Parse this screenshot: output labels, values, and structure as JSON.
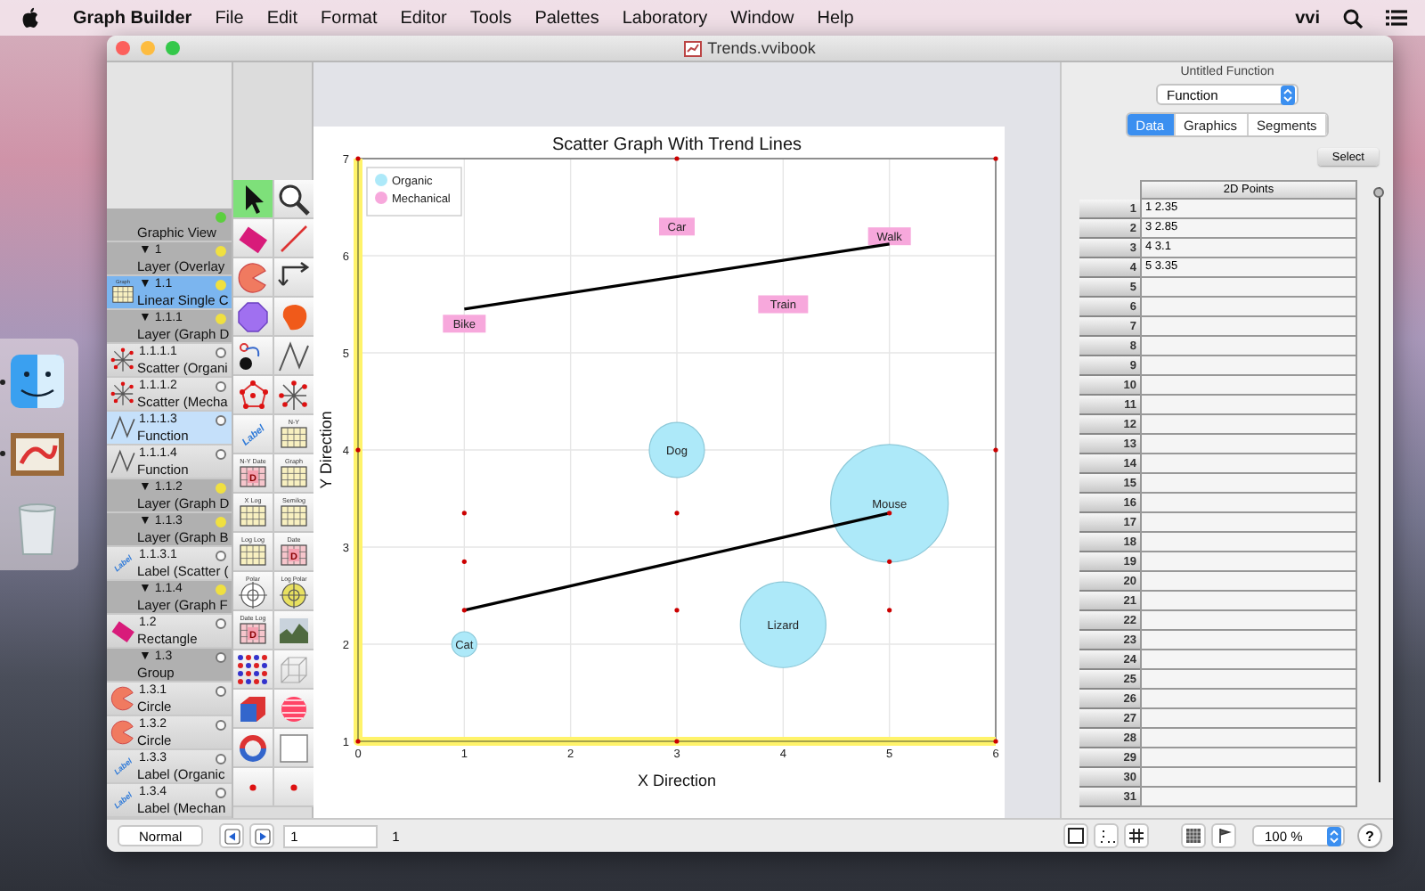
{
  "menubar": {
    "app": "Graph Builder",
    "menus": [
      "File",
      "Edit",
      "Format",
      "Editor",
      "Tools",
      "Palettes",
      "Laboratory",
      "Window",
      "Help"
    ],
    "user": "vvi"
  },
  "dock": {
    "items": [
      {
        "kind": "finder",
        "running": true
      },
      {
        "kind": "picture",
        "running": true
      },
      {
        "kind": "trash",
        "running": false
      }
    ]
  },
  "window": {
    "title": "Trends.vvibook"
  },
  "layers": [
    {
      "name": "Graphic View",
      "kind": "view",
      "color": "#5ccf3f",
      "selected": false,
      "editing": false,
      "children": [
        {
          "number": "▼ 1",
          "name": "Layer (Overlay",
          "kind": "layer",
          "color": "#f0e040",
          "selected": false,
          "editing": false,
          "children": [
            {
              "number": "▼ 1.1",
              "name": "Linear Single C",
              "kind": "graph",
              "icon_text": "Graph",
              "color": "#f0e040",
              "selected": true,
              "editing": false,
              "children": [
                {
                  "number": "▼ 1.1.1",
                  "name": "Layer (Graph D",
                  "kind": "layer",
                  "color": "#f0e040",
                  "selected": false,
                  "editing": false,
                  "children": [
                    {
                      "number": "1.1.1.1",
                      "name": "Scatter (Organi",
                      "kind": "scatter",
                      "selected": false,
                      "editing": false
                    },
                    {
                      "number": "1.1.1.2",
                      "name": "Scatter (Mecha",
                      "kind": "scatter",
                      "selected": false,
                      "editing": false
                    },
                    {
                      "number": "1.1.1.3",
                      "name": "Function",
                      "kind": "function",
                      "selected": false,
                      "editing": true
                    },
                    {
                      "number": "1.1.1.4",
                      "name": "Function",
                      "kind": "function",
                      "selected": false,
                      "editing": false
                    }
                  ]
                },
                {
                  "number": "▼ 1.1.2",
                  "name": "Layer (Graph D",
                  "kind": "layer",
                  "color": "#f0e040",
                  "selected": false,
                  "editing": false
                },
                {
                  "number": "▼ 1.1.3",
                  "name": "Layer (Graph B",
                  "kind": "layer",
                  "color": "#f0e040",
                  "selected": false,
                  "editing": false,
                  "children": [
                    {
                      "number": "1.1.3.1",
                      "name": "Label (Scatter (",
                      "kind": "label",
                      "icon_text": "Label",
                      "selected": false,
                      "editing": false
                    }
                  ]
                },
                {
                  "number": "▼ 1.1.4",
                  "name": "Layer (Graph F",
                  "kind": "layer",
                  "color": "#f0e040",
                  "selected": false,
                  "editing": false
                }
              ]
            },
            {
              "number": "1.2",
              "name": "Rectangle",
              "kind": "rectangle",
              "selected": false,
              "editing": false
            },
            {
              "number": "▼ 1.3",
              "name": "Group",
              "kind": "group",
              "selected": false,
              "editing": false,
              "children": [
                {
                  "number": "1.3.1",
                  "name": "Circle",
                  "kind": "circle",
                  "selected": false,
                  "editing": false
                },
                {
                  "number": "1.3.2",
                  "name": "Circle",
                  "kind": "circle",
                  "selected": false,
                  "editing": false
                },
                {
                  "number": "1.3.3",
                  "name": "Label (Organic",
                  "kind": "label",
                  "icon_text": "Label",
                  "selected": false,
                  "editing": false
                },
                {
                  "number": "1.3.4",
                  "name": "Label (Mechan",
                  "kind": "label",
                  "icon_text": "Label",
                  "selected": false,
                  "editing": false
                }
              ]
            }
          ]
        }
      ]
    }
  ],
  "tools": [
    {
      "kind": "pointer",
      "selected": true
    },
    {
      "kind": "zoom",
      "selected": false
    },
    {
      "kind": "rectangle",
      "selected": false
    },
    {
      "kind": "line",
      "selected": false
    },
    {
      "kind": "pie",
      "selected": false
    },
    {
      "kind": "connector",
      "selected": false
    },
    {
      "kind": "polygon",
      "selected": false
    },
    {
      "kind": "blob",
      "selected": false
    },
    {
      "kind": "curve",
      "selected": false
    },
    {
      "kind": "polyline",
      "selected": false
    },
    {
      "kind": "dots",
      "selected": false
    },
    {
      "kind": "scatter",
      "selected": false
    },
    {
      "kind": "label",
      "caption": "Label",
      "selected": false
    },
    {
      "kind": "grid",
      "caption": "N-Y",
      "selected": false
    },
    {
      "kind": "date",
      "caption": "N-Y Date",
      "letter": "D",
      "selected": false
    },
    {
      "kind": "grid",
      "caption": "Graph",
      "selected": false
    },
    {
      "kind": "grid",
      "caption": "X Log",
      "selected": false
    },
    {
      "kind": "grid",
      "caption": "Semilog",
      "selected": false
    },
    {
      "kind": "grid",
      "caption": "Log Log",
      "selected": false
    },
    {
      "kind": "date",
      "caption": "Date",
      "letter": "D",
      "selected": false
    },
    {
      "kind": "polar",
      "caption": "Polar",
      "selected": false
    },
    {
      "kind": "logpolar",
      "caption": "Log Polar",
      "selected": false
    },
    {
      "kind": "date",
      "caption": "Date Log",
      "letter": "D",
      "selected": false
    },
    {
      "kind": "photo",
      "selected": false
    },
    {
      "kind": "dotgrid",
      "selected": false
    },
    {
      "kind": "cube",
      "selected": false
    },
    {
      "kind": "box",
      "selected": false
    },
    {
      "kind": "sphere",
      "selected": false
    },
    {
      "kind": "ring",
      "selected": false
    },
    {
      "kind": "frame",
      "selected": false
    },
    {
      "kind": "point",
      "selected": false
    },
    {
      "kind": "point",
      "selected": false
    }
  ],
  "graph": {
    "chart_data": {
      "type": "scatter",
      "title": "Scatter Graph With Trend Lines",
      "xlabel": "X Direction",
      "ylabel": "Y Direction",
      "xlim": [
        0,
        6
      ],
      "ylim": [
        1,
        7
      ],
      "xticks": [
        {
          "value": 0,
          "label": "0"
        },
        {
          "value": 1,
          "label": "1"
        },
        {
          "value": 2,
          "label": "2"
        },
        {
          "value": 3,
          "label": "3"
        },
        {
          "value": 4,
          "label": "4"
        },
        {
          "value": 5,
          "label": "5"
        },
        {
          "value": 6,
          "label": "6"
        }
      ],
      "yticks": [
        {
          "value": 1,
          "label": "1"
        },
        {
          "value": 2,
          "label": "2"
        },
        {
          "value": 3,
          "label": "3"
        },
        {
          "value": 4,
          "label": "4"
        },
        {
          "value": 5,
          "label": "5"
        },
        {
          "value": 6,
          "label": "6"
        },
        {
          "value": 7,
          "label": "7"
        }
      ],
      "grid": true,
      "legend": true,
      "series": [
        {
          "name": "Organic",
          "type": "scatter",
          "color": "#ade9f9",
          "x": [
            1,
            3,
            4,
            5
          ],
          "values": [
            2,
            4,
            2.2,
            3.45
          ],
          "sizes": [
            0.045,
            0.22,
            0.53,
            1
          ]
        },
        {
          "name": "Mechanical",
          "type": "scatter",
          "color": "#f7a8dc",
          "x": [
            1,
            3,
            4,
            5
          ],
          "values": [
            5.3,
            6.3,
            5.5,
            6.2
          ]
        },
        {
          "type": "line",
          "color": "#000000",
          "x": [
            1,
            5
          ],
          "values": [
            5.45,
            6.12
          ]
        },
        {
          "type": "line",
          "color": "#000000",
          "x": [
            1,
            3,
            4,
            5
          ],
          "values": [
            2.35,
            2.85,
            3.1,
            3.35
          ]
        }
      ],
      "annotations": [
        {
          "x": 1,
          "y": 2,
          "text": "Cat"
        },
        {
          "x": 3,
          "y": 4,
          "text": "Dog"
        },
        {
          "x": 4,
          "y": 2.2,
          "text": "Lizard"
        },
        {
          "x": 5,
          "y": 3.45,
          "text": "Mouse"
        },
        {
          "x": 1,
          "y": 5.3,
          "text": "Bike"
        },
        {
          "x": 3,
          "y": 6.3,
          "text": "Car"
        },
        {
          "x": 4,
          "y": 5.5,
          "text": "Train"
        },
        {
          "x": 5,
          "y": 6.2,
          "text": "Walk"
        }
      ]
    }
  },
  "inspector": {
    "caption": "Untitled Function",
    "type": "Function",
    "tabs": [
      {
        "label": "Data",
        "selected": true
      },
      {
        "label": "Graphics",
        "selected": false
      },
      {
        "label": "Segments",
        "selected": false
      }
    ],
    "select_button": "Select",
    "column": "2D Points",
    "slider": {
      "level": 0
    },
    "rows": [
      {
        "number": "1",
        "value": "1 2.35"
      },
      {
        "number": "2",
        "value": "3 2.85"
      },
      {
        "number": "3",
        "value": "4 3.1"
      },
      {
        "number": "4",
        "value": "5 3.35"
      },
      {
        "number": "5"
      },
      {
        "number": "6"
      },
      {
        "number": "7"
      },
      {
        "number": "8"
      },
      {
        "number": "9"
      },
      {
        "number": "10"
      },
      {
        "number": "11"
      },
      {
        "number": "12"
      },
      {
        "number": "13"
      },
      {
        "number": "14"
      },
      {
        "number": "15"
      },
      {
        "number": "16"
      },
      {
        "number": "17"
      },
      {
        "number": "18"
      },
      {
        "number": "19"
      },
      {
        "number": "20"
      },
      {
        "number": "21"
      },
      {
        "number": "22"
      },
      {
        "number": "23"
      },
      {
        "number": "24"
      },
      {
        "number": "25"
      },
      {
        "number": "26"
      },
      {
        "number": "27"
      },
      {
        "number": "28"
      },
      {
        "number": "29"
      },
      {
        "number": "30"
      },
      {
        "number": "31"
      }
    ]
  },
  "bottom_bar": {
    "mode_button": "Normal",
    "page_field": "1",
    "page_count": "1",
    "zoom": "100 %",
    "help": "?"
  }
}
